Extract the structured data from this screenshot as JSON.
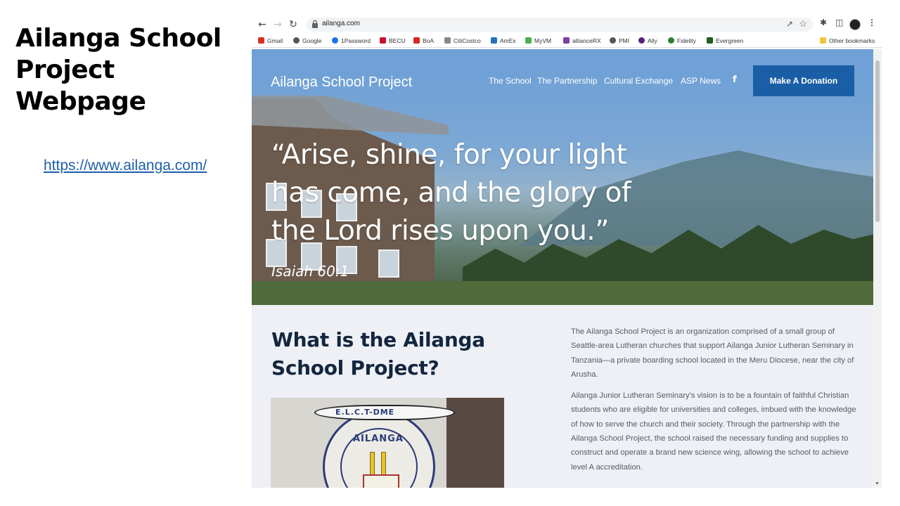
{
  "slide": {
    "title": "Ailanga School Project Webpage",
    "link": "https://www.ailanga.com/"
  },
  "browser": {
    "url": "ailanga.com",
    "bookmarks": [
      {
        "label": "Gmail",
        "icon": "gmail-icon",
        "color": "#d93025"
      },
      {
        "label": "Google",
        "icon": "globe-icon",
        "color": "#555555"
      },
      {
        "label": "1Password",
        "icon": "onepassword-icon",
        "color": "#1a73e8"
      },
      {
        "label": "BECU",
        "icon": "becu-icon",
        "color": "#c8102e"
      },
      {
        "label": "BoA",
        "icon": "boa-icon",
        "color": "#d52b1e"
      },
      {
        "label": "CitiCostco",
        "icon": "citi-icon",
        "color": "#555555"
      },
      {
        "label": "AmEx",
        "icon": "amex-icon",
        "color": "#2671b9"
      },
      {
        "label": "MyVM",
        "icon": "myvm-icon",
        "color": "#4caf50"
      },
      {
        "label": "allianceRX",
        "icon": "alliancerx-icon",
        "color": "#7b3fa0"
      },
      {
        "label": "PMI",
        "icon": "globe-icon",
        "color": "#555555"
      },
      {
        "label": "Ally",
        "icon": "ally-icon",
        "color": "#5a1f7a"
      },
      {
        "label": "Fidelity",
        "icon": "fidelity-icon",
        "color": "#2e7d32"
      },
      {
        "label": "Evergreen",
        "icon": "evergreen-icon",
        "color": "#1b5e20"
      }
    ],
    "other_bookmarks": "Other bookmarks"
  },
  "site": {
    "logo": "Ailanga School Project",
    "nav": [
      "The School",
      "The Partnership",
      "Cultural Exchange",
      "ASP News"
    ],
    "facebook": "f",
    "donate_label": "Make A Donation",
    "accent": "#1a5fa6",
    "quote": "“Arise, shine, for your light has come, and the glory of the Lord rises upon you.”",
    "quote_ref": "Isaiah 60:1",
    "about": {
      "heading": "What is the Ailanga School Project?",
      "paragraphs": [
        "The Ailanga School Project is an organization comprised of a small group of Seattle-area Lutheran churches that support Ailanga Junior Lutheran Seminary in Tanzania—a private boarding school located in the Meru Diocese, near the city of Arusha.",
        "Ailanga Junior Lutheran Seminary’s vision is to be a fountain of faithful Christian students who are eligible for universities and colleges, imbued with the knowledge of how to serve the church and their society. Through the partnership with the Ailanga School Project, the school raised the necessary funding and supplies to construct and operate a brand new science wing, allowing the school to achieve level A accreditation."
      ],
      "seal_ribbon": "E.L.C.T-DME",
      "seal_name": "AILANGA"
    }
  }
}
